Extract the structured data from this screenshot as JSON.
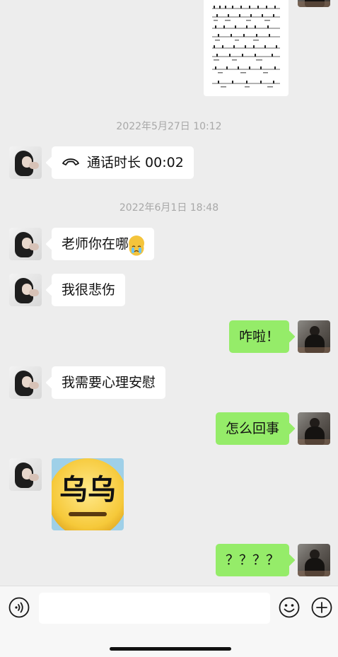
{
  "timestamps": {
    "t1": "2022年5月27日 10:12",
    "t2": "2022年6月1日 18:48"
  },
  "messages": {
    "call": "通话时长 00:02",
    "m1": "老师你在哪",
    "m2": "我很悲伤",
    "m3": "咋啦！",
    "m4": "我需要心理安慰",
    "m5": "怎么回事",
    "m6": "？？？？"
  },
  "sticker_text": "乌乌",
  "input": {
    "value": "",
    "placeholder": ""
  },
  "colors": {
    "sent_bubble": "#95ec69",
    "received_bubble": "#ffffff",
    "background": "#ededed"
  },
  "icons": {
    "voice": "voice-icon",
    "emoji": "emoji-icon",
    "plus": "plus-icon",
    "call": "phone-icon"
  }
}
